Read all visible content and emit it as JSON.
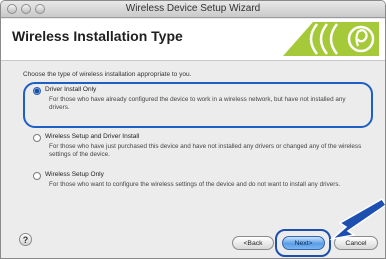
{
  "window": {
    "title": "Wireless Device Setup Wizard"
  },
  "header": {
    "title": "Wireless Installation Type"
  },
  "instruction": "Choose the type of wireless installation appropriate to you.",
  "options": [
    {
      "label": "Driver Install Only",
      "description": "For those who have already configured the device to work in a wireless network, but have not installed any drivers.",
      "selected": true
    },
    {
      "label": "Wireless Setup and Driver Install",
      "description": "For those who have just purchased this device and have not installed any drivers or changed any of the wireless settings of the device.",
      "selected": false
    },
    {
      "label": "Wireless Setup Only",
      "description": "For those who want to configure the wireless settings of the device and do not want to install any drivers.",
      "selected": false
    }
  ],
  "buttons": {
    "help": "?",
    "back": "<Back",
    "next": "Next>",
    "cancel": "Cancel"
  },
  "colors": {
    "accent": "#1d5fc4",
    "logo_green": "#a6c93a",
    "arrow": "#1d4fb0"
  },
  "icons": {
    "help": "help-icon",
    "logo": "wireless-logo-icon",
    "pointer": "pointer-arrow-icon"
  }
}
